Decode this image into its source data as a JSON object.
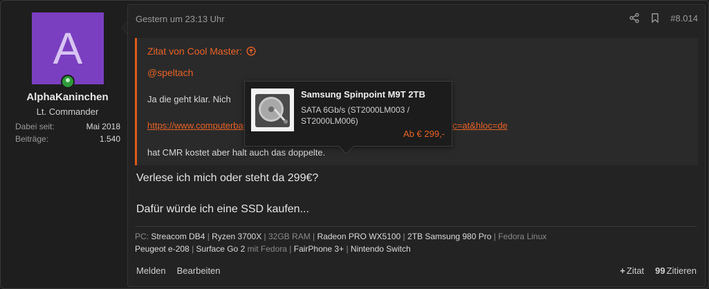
{
  "user": {
    "avatar_letter": "A",
    "avatar_color": "#7a3fc0",
    "username": "AlphaKaninchen",
    "rank": "Lt. Commander",
    "stats": [
      {
        "label": "Dabei seit:",
        "value": "Mai 2018"
      },
      {
        "label": "Beiträge:",
        "value": "1.540"
      }
    ]
  },
  "post": {
    "timestamp": "Gestern um 23:13 Uhr",
    "post_number": "#8.014",
    "quote": {
      "header": "Zitat von Cool Master:",
      "mention": "@speltach",
      "line1": "Ja die geht klar. Nich",
      "link": "https://www.computerbase.de/preisve...003-st2000lm006-a1135990.html?hloc=at&hloc=de",
      "line2": "hat CMR kostet aber halt auch das doppelte."
    },
    "tooltip": {
      "title": "Samsung Spinpoint M9T 2TB",
      "description": "SATA 6Gb/s (ST2000LM003 / ST2000LM006)",
      "price": "Ab € 299,-"
    },
    "body": [
      "Verlese ich mich oder steht da 299€?",
      "Dafür würde ich eine SSD kaufen..."
    ],
    "signature": {
      "line1": [
        {
          "text": "PC: ",
          "bright": false
        },
        {
          "text": "Streacom DB4",
          "bright": true
        },
        {
          "text": " | ",
          "bright": false
        },
        {
          "text": "Ryzen 3700X",
          "bright": true
        },
        {
          "text": " | 32GB RAM | ",
          "bright": false
        },
        {
          "text": "Radeon PRO WX5100",
          "bright": true
        },
        {
          "text": " | ",
          "bright": false
        },
        {
          "text": "2TB Samsung 980 Pro",
          "bright": true
        },
        {
          "text": " | Fedora Linux",
          "bright": false
        }
      ],
      "line2": [
        {
          "text": "Peugeot e-208",
          "bright": true
        },
        {
          "text": " | ",
          "bright": false
        },
        {
          "text": "Surface Go 2",
          "bright": true
        },
        {
          "text": " mit Fedora | ",
          "bright": false
        },
        {
          "text": "FairPhone 3+",
          "bright": true
        },
        {
          "text": " | ",
          "bright": false
        },
        {
          "text": "Nintendo Switch",
          "bright": true
        }
      ]
    },
    "footer": {
      "report": "Melden",
      "edit": "Bearbeiten",
      "quote_add": "Zitat",
      "quote_add_glyph": "+",
      "quote_reply": "Zitieren",
      "quote_reply_glyph": "99"
    }
  },
  "colors": {
    "accent": "#e86226",
    "online": "#2d9b3a"
  }
}
